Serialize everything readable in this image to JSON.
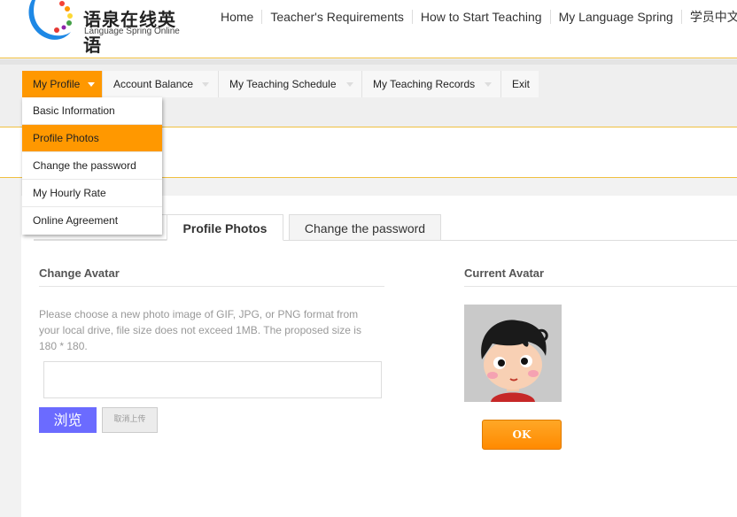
{
  "header": {
    "logo_cn": "语泉在线英语",
    "logo_en": "Language Spring Online",
    "nav": [
      "Home",
      "Teacher's Requirements",
      "How to Start Teaching",
      "My Language Spring",
      "学员中文"
    ]
  },
  "menu": {
    "items": [
      "My Profile",
      "Account Balance",
      "My Teaching Schedule",
      "My Teaching Records",
      "Exit"
    ],
    "active": "My Profile"
  },
  "dropdown": {
    "items": [
      "Basic Information",
      "Profile Photos",
      "Change the password",
      "My Hourly Rate",
      "Online Agreement"
    ],
    "active": "Profile Photos"
  },
  "tabs": {
    "items": [
      "Profile Photos",
      "Change the password"
    ],
    "active": "Profile Photos"
  },
  "change_avatar": {
    "title": "Change Avatar",
    "hint": "Please choose a new photo image of GIF, JPG, or PNG format from your local drive, file size does not exceed 1MB. The proposed size is 180 * 180.",
    "browse_label": "浏览",
    "cancel_label": "取消上传"
  },
  "current_avatar": {
    "title": "Current Avatar",
    "ok_label": "OK"
  },
  "colors": {
    "accent": "#ff9800",
    "browse": "#6b6bff"
  }
}
